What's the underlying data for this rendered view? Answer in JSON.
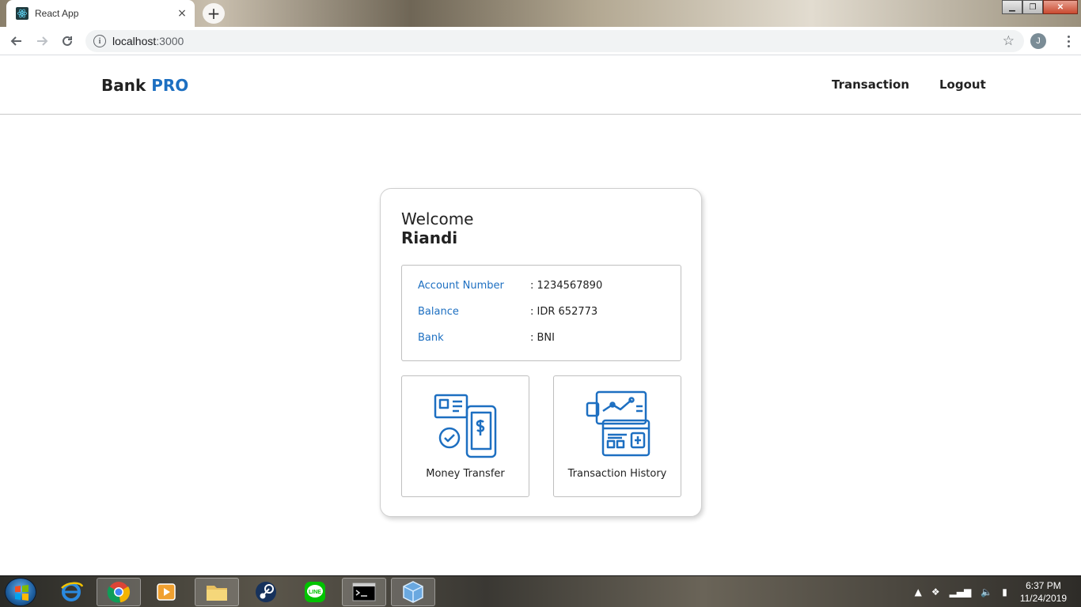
{
  "browser": {
    "tab_title": "React App",
    "tab_close": "×",
    "new_tab": "+",
    "url_host": "localhost",
    "url_port": ":3000",
    "profile_initial": "J",
    "window_controls": {
      "minimize": "▁",
      "maximize": "❐",
      "close": "✕"
    }
  },
  "app": {
    "brand": "Bank",
    "brand_accent": "PRO",
    "nav": {
      "transaction": "Transaction",
      "logout": "Logout"
    }
  },
  "card": {
    "welcome": "Welcome",
    "username": "Riandi",
    "info": [
      {
        "label": "Account Number",
        "value": ": 1234567890"
      },
      {
        "label": "Balance",
        "value": ": IDR 652773"
      },
      {
        "label": "Bank",
        "value": ": BNI"
      }
    ],
    "actions": {
      "money_transfer": "Money Transfer",
      "transaction_history": "Transaction History"
    }
  },
  "taskbar": {
    "time": "6:37 PM",
    "date": "11/24/2019",
    "apps": [
      "internet-explorer-icon",
      "chrome-icon",
      "media-player-icon",
      "file-explorer-icon",
      "steam-icon",
      "line-icon",
      "command-prompt-icon",
      "virtualbox-icon"
    ]
  },
  "colors": {
    "accent": "#1d6fc1",
    "text": "#222222",
    "border": "#bfbfbf"
  }
}
